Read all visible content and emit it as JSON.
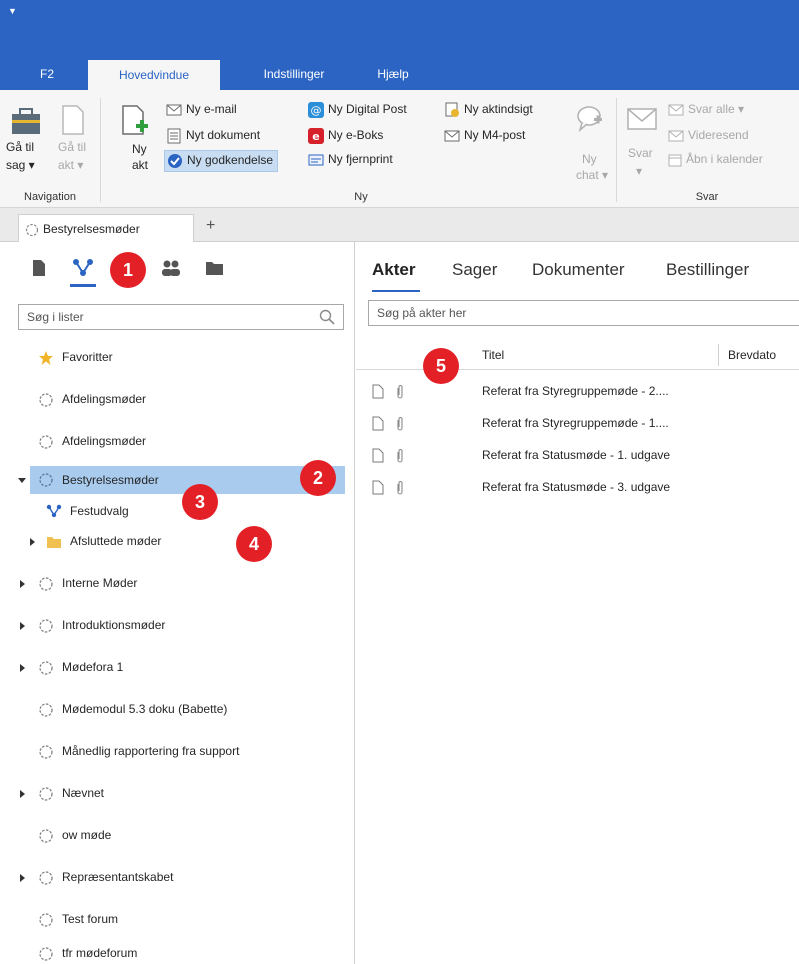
{
  "titlebar": {
    "quick_access": "▼"
  },
  "ribbon_tabs": [
    {
      "label": "F2"
    },
    {
      "label": "Hovedvindue"
    },
    {
      "label": "Indstillinger"
    },
    {
      "label": "Hjælp"
    }
  ],
  "ribbon": {
    "navigation": {
      "goto_case_l1": "Gå til",
      "goto_case_l2": "sag ▾",
      "goto_act_l1": "Gå til",
      "goto_act_l2": "akt ▾",
      "group_label": "Navigation"
    },
    "new": {
      "new_act_l1": "Ny",
      "new_act_l2": "akt",
      "new_email": "Ny e-mail",
      "new_document": "Nyt dokument",
      "new_approval": "Ny godkendelse",
      "new_digital_post": "Ny Digital Post",
      "new_eboks": "Ny e-Boks",
      "new_remote_print": "Ny fjernprint",
      "new_access_request": "Ny aktindsigt",
      "new_m4_post": "Ny M4-post",
      "new_chat_l1": "Ny",
      "new_chat_l2": "chat ▾",
      "group_label": "Ny"
    },
    "reply": {
      "reply_l1": "Svar",
      "reply_l2": "▾",
      "reply_all": "Svar alle ▾",
      "forward": "Videresend",
      "open_calendar": "Åbn i kalender",
      "group_label": "Svar"
    }
  },
  "doc_tabs": [
    {
      "label": "Bestyrelsesmøder"
    }
  ],
  "doc_tab_add": "+",
  "left": {
    "search_placeholder": "Søg i lister",
    "tree": [
      {
        "label": "Favoritter"
      },
      {
        "label": "Afdelingsmøder"
      },
      {
        "label": "Afdelingsmøder"
      },
      {
        "label": "Bestyrelsesmøder"
      },
      {
        "label": "Festudvalg"
      },
      {
        "label": "Afsluttede møder"
      },
      {
        "label": "Interne Møder"
      },
      {
        "label": "Introduktionsmøder"
      },
      {
        "label": "Mødefora 1"
      },
      {
        "label": "Mødemodul 5.3 doku (Babette)"
      },
      {
        "label": "Månedlig rapportering fra support"
      },
      {
        "label": "Nævnet"
      },
      {
        "label": "ow møde"
      },
      {
        "label": "Repræsentantskabet"
      },
      {
        "label": "Test forum"
      },
      {
        "label": "tfr mødeforum"
      }
    ]
  },
  "right": {
    "tabs": [
      {
        "label": "Akter"
      },
      {
        "label": "Sager"
      },
      {
        "label": "Dokumenter"
      },
      {
        "label": "Bestillinger"
      }
    ],
    "search_placeholder": "Søg på akter her",
    "columns": {
      "title": "Titel",
      "letter_date": "Brevdato"
    },
    "rows": [
      {
        "title": "Referat fra Styregruppemøde - 2...."
      },
      {
        "title": "Referat fra Styregruppemøde - 1...."
      },
      {
        "title": "Referat fra Statusmøde - 1. udgave"
      },
      {
        "title": "Referat fra Statusmøde - 3. udgave"
      }
    ]
  },
  "badges": [
    "1",
    "2",
    "3",
    "4",
    "5"
  ],
  "colors": {
    "accent": "#2b64c3",
    "selection": "#a8cbee",
    "badge": "#e32026"
  }
}
